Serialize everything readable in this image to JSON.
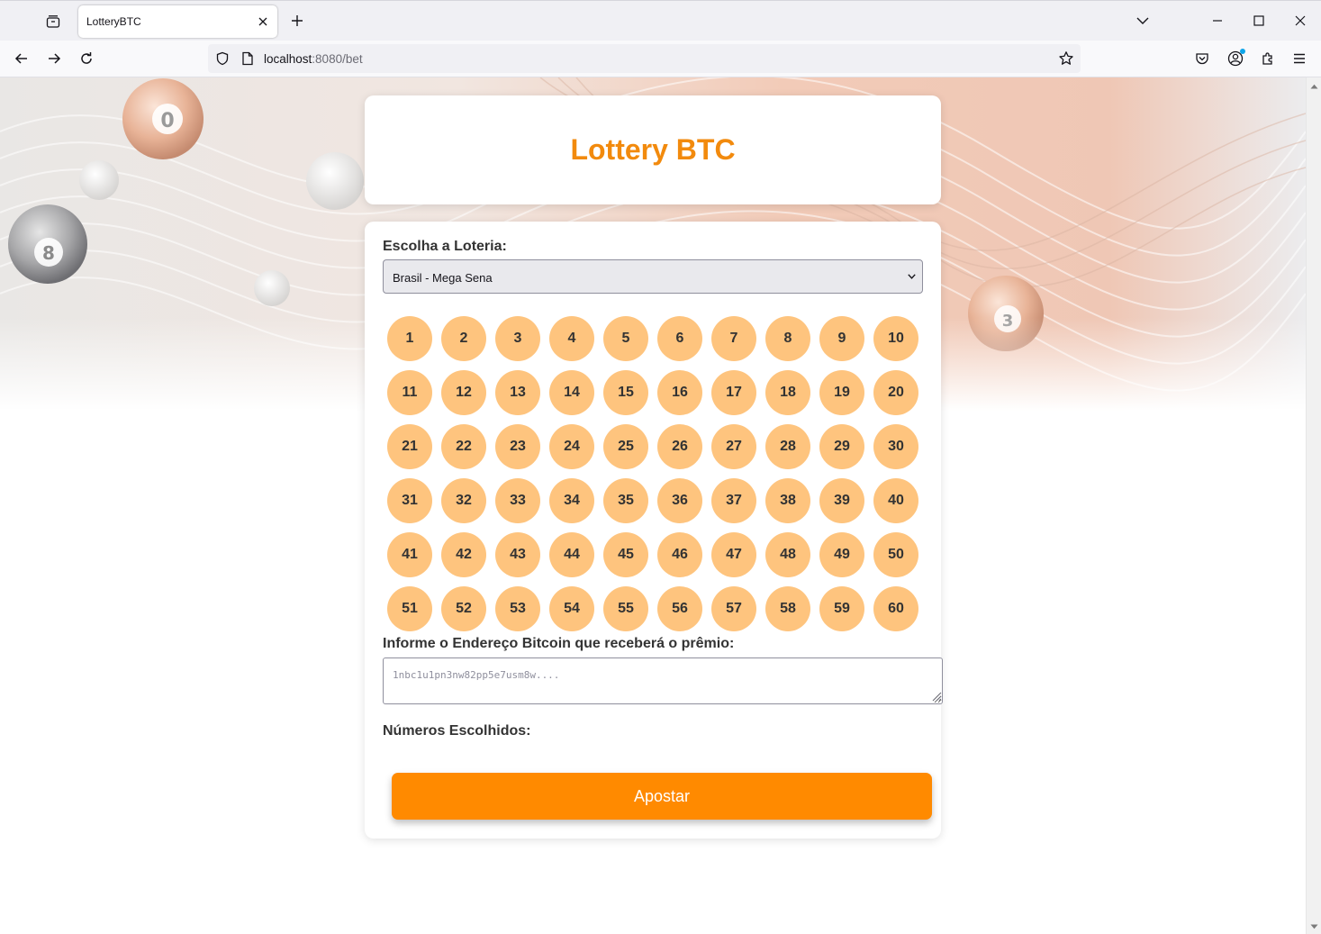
{
  "browser": {
    "tab_title": "LotteryBTC",
    "url_host": "localhost",
    "url_path": ":8080/bet"
  },
  "page": {
    "title": "Lottery BTC",
    "lottery_label": "Escolha a Loteria:",
    "lottery_selected": "Brasil - Mega Sena",
    "numbers": [
      "1",
      "2",
      "3",
      "4",
      "5",
      "6",
      "7",
      "8",
      "9",
      "10",
      "11",
      "12",
      "13",
      "14",
      "15",
      "16",
      "17",
      "18",
      "19",
      "20",
      "21",
      "22",
      "23",
      "24",
      "25",
      "26",
      "27",
      "28",
      "29",
      "30",
      "31",
      "32",
      "33",
      "34",
      "35",
      "36",
      "37",
      "38",
      "39",
      "40",
      "41",
      "42",
      "43",
      "44",
      "45",
      "46",
      "47",
      "48",
      "49",
      "50",
      "51",
      "52",
      "53",
      "54",
      "55",
      "56",
      "57",
      "58",
      "59",
      "60"
    ],
    "address_label": "Informe o Endereço Bitcoin que receberá o prêmio:",
    "address_placeholder": "1nbc1u1pn3nw82pp5e7usm8w....",
    "chosen_label": "Números Escolhidos:",
    "submit_label": "Apostar"
  },
  "colors": {
    "accent": "#ff8a00",
    "title": "#f28a0d",
    "ball": "#fec47e"
  }
}
